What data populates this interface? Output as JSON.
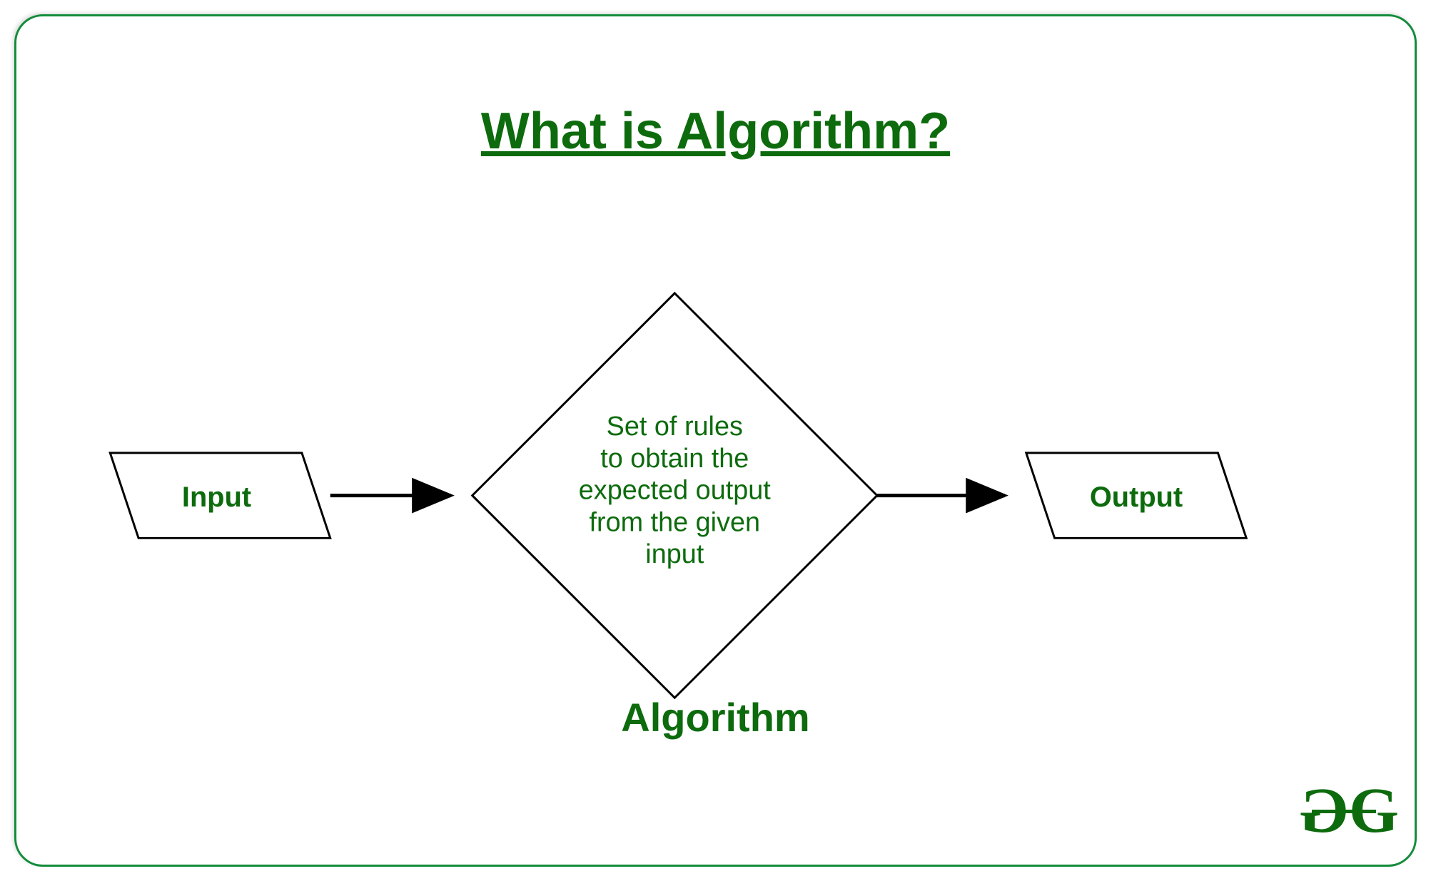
{
  "title": "What is Algorithm?",
  "nodes": {
    "input": "Input",
    "output": "Output",
    "center_lines": [
      "Set of rules",
      "to obtain the",
      "expected output",
      "from the given",
      "input"
    ],
    "algorithm_label": "Algorithm"
  },
  "logo": {
    "left": "G",
    "right": "G"
  },
  "colors": {
    "brand_green": "#0d6b0d",
    "border_green": "#138c3b",
    "stroke": "#000000"
  }
}
